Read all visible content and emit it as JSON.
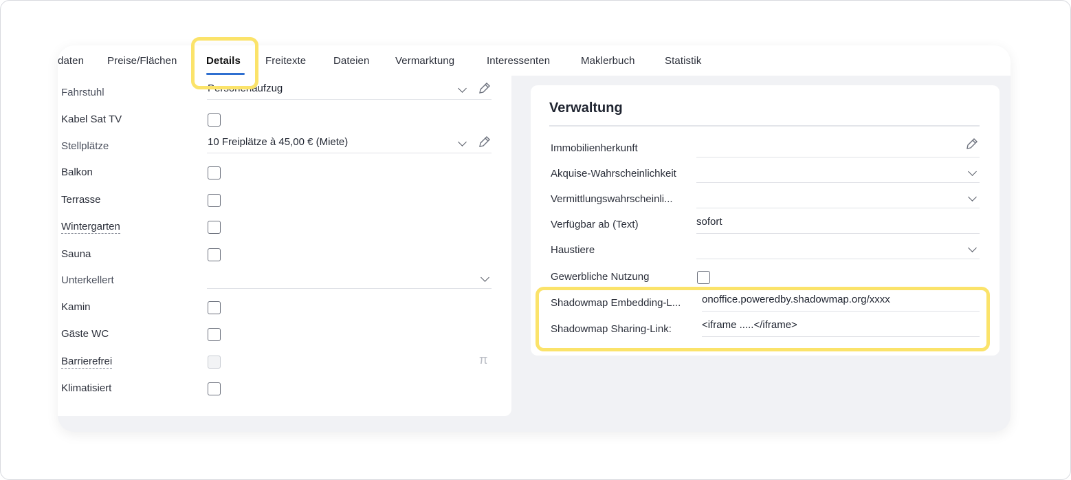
{
  "tabs": [
    {
      "label": "daten"
    },
    {
      "label": "Preise/Flächen"
    },
    {
      "label": "Details"
    },
    {
      "label": "Freitexte"
    },
    {
      "label": "Dateien"
    },
    {
      "label": "Vermarktung"
    },
    {
      "label": "Interessenten"
    },
    {
      "label": "Maklerbuch"
    },
    {
      "label": "Statistik"
    }
  ],
  "active_tab": "Details",
  "highlight_color": "#fbe36a",
  "accent_color": "#2f6fd0",
  "details": {
    "rows": [
      {
        "label": "Fahrstuhl",
        "type": "select",
        "value": "Personenaufzug",
        "editable_icon": "pencil-icon"
      },
      {
        "label": "Kabel Sat TV",
        "type": "checkbox",
        "checked": false
      },
      {
        "label": "Stellplätze",
        "type": "select",
        "value": "10 Freiplätze à 45,00 € (Miete)",
        "editable_icon": "pencil-icon"
      },
      {
        "label": "Balkon",
        "type": "checkbox",
        "checked": false
      },
      {
        "label": "Terrasse",
        "type": "checkbox",
        "checked": false
      },
      {
        "label": "Wintergarten",
        "type": "checkbox",
        "checked": false
      },
      {
        "label": "Sauna",
        "type": "checkbox",
        "checked": false
      },
      {
        "label": "Unterkellert",
        "type": "select",
        "value": ""
      },
      {
        "label": "Kamin",
        "type": "checkbox",
        "checked": false
      },
      {
        "label": "Gäste WC",
        "type": "checkbox",
        "checked": false
      },
      {
        "label": "Barrierefrei",
        "type": "checkbox",
        "checked": false,
        "disabled": true,
        "extra_icon": "pi-icon",
        "extra_glyph": "π"
      },
      {
        "label": "Klimatisiert",
        "type": "checkbox",
        "checked": false
      }
    ]
  },
  "verwaltung": {
    "title": "Verwaltung",
    "rows": [
      {
        "label": "Immobilienherkunft",
        "type": "text",
        "value": "",
        "icon": "pencil-icon"
      },
      {
        "label": "Akquise-Wahrscheinlichkeit",
        "type": "select",
        "value": ""
      },
      {
        "label": "Vermittlungswahrscheinli...",
        "type": "select",
        "value": ""
      },
      {
        "label": "Verfügbar ab (Text)",
        "type": "text",
        "value": "sofort"
      },
      {
        "label": "Haustiere",
        "type": "select",
        "value": ""
      },
      {
        "label": "Gewerbliche Nutzung",
        "type": "checkbox",
        "checked": false
      },
      {
        "label": "Shadowmap Embedding-L...",
        "type": "text",
        "value": "onoffice.poweredby.shadowmap.org/xxxx"
      },
      {
        "label": "Shadowmap Sharing-Link:",
        "type": "text",
        "value": "<iframe .....</iframe>"
      }
    ]
  }
}
